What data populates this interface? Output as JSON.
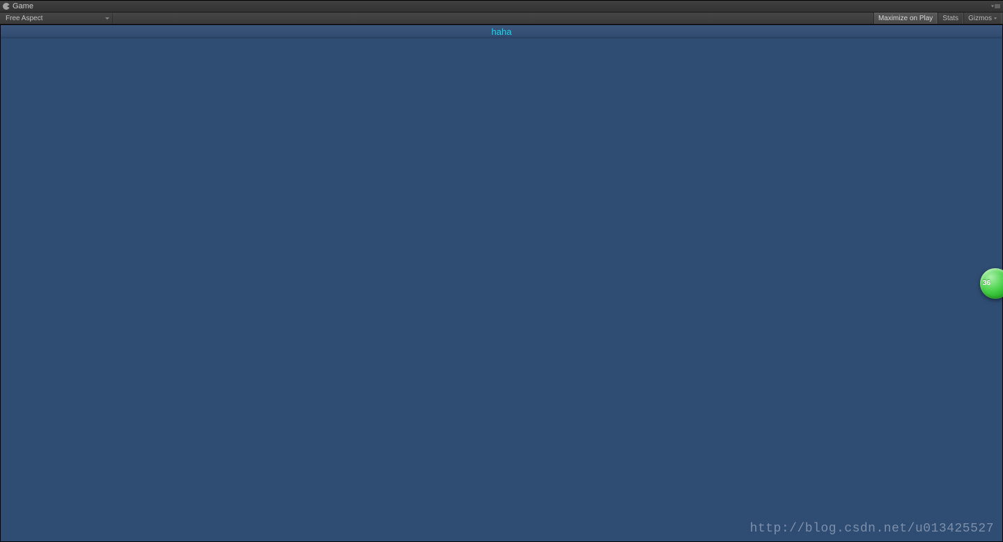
{
  "tab": {
    "title": "Game",
    "icon": "pacman-icon"
  },
  "toolbar": {
    "aspect_label": "Free Aspect",
    "maximize_label": "Maximize on Play",
    "stats_label": "Stats",
    "gizmos_label": "Gizmos"
  },
  "game_ui": {
    "top_text": "haha"
  },
  "float_badge": {
    "text": "36"
  },
  "watermark": {
    "text": "http://blog.csdn.net/u013425527"
  }
}
